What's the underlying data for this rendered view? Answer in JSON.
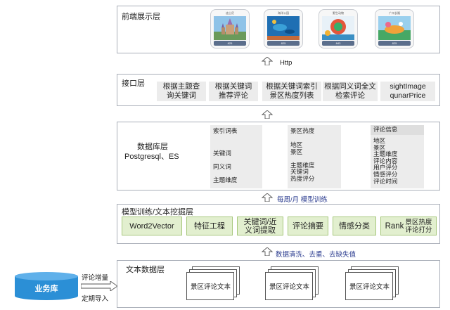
{
  "layers": {
    "frontend": {
      "title": "前端展示层"
    },
    "interface": {
      "title": "接口层",
      "items": [
        "根据主题查\n询关键词",
        "根据关键词\n推荐评论",
        "根据关键词索引\n景区热度列表",
        "根据同义词全文\n检索评论",
        "sightImage\nqunarPrice"
      ]
    },
    "database": {
      "title_line1": "数据库层",
      "title_line2": "Postgresql、ES",
      "col1": {
        "head": "索引词表",
        "body": "关键词\n\n同义词\n\n主题维度"
      },
      "col2": {
        "head": "景区热度",
        "body": "地区\n景区\n\n主题维度\n关键词\n热度评分"
      },
      "col3": {
        "head": "评论信息",
        "body": "地区\n景区\n主题维度\n评论内容\n用户评分\n情感评分\n评论时间"
      }
    },
    "model": {
      "title": "模型训练/文本挖掘层",
      "items": [
        "Word2Vector",
        "特征工程",
        "关键词/近\n义词提取",
        "评论摘要",
        "情感分类"
      ],
      "rank_main": "Rank",
      "rank_sub": "景区热度\n评论打分"
    },
    "text": {
      "title": "文本数据层",
      "docs": [
        "景区评论文本",
        "景区评论文本",
        "景区评论文本"
      ]
    }
  },
  "arrows": {
    "http": "Http",
    "weekly": "每周/月 模型训练",
    "clean": "数据清洗、去重、去缺失值"
  },
  "business": {
    "db_label": "业务库",
    "line1": "评论增量",
    "line2": "定期导入"
  },
  "phones": [
    {
      "caption": "迪士尼",
      "count": "825"
    },
    {
      "caption": "海洋公园",
      "count": "825"
    },
    {
      "caption": "野生动物",
      "count": "843"
    },
    {
      "caption": "广州长隆",
      "count": "825"
    }
  ],
  "colors": {
    "layer_border": "#a9aeb8",
    "box_gray": "#ececec",
    "model_green": "#e2efcf",
    "model_green_border": "#a8c87e",
    "business_blue": "#2b8fd6",
    "arrow_text": "#2a3b8f"
  }
}
